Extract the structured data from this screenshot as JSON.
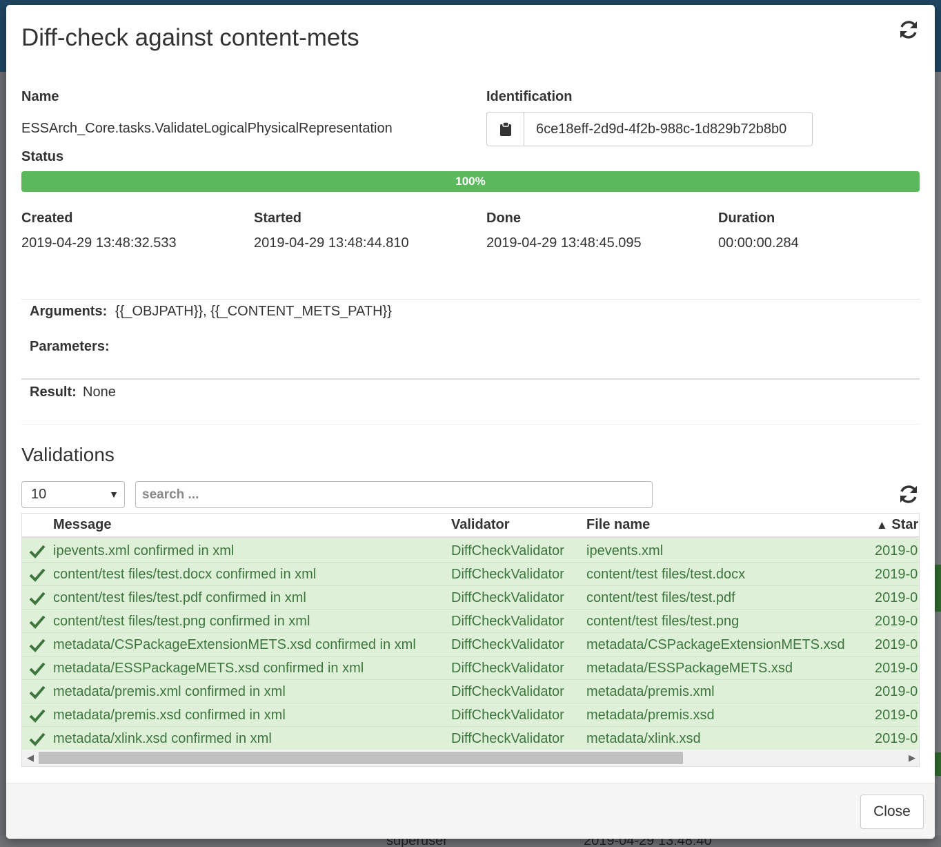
{
  "modal": {
    "title": "Diff-check against content-mets"
  },
  "details": {
    "name_label": "Name",
    "name_value": "ESSArch_Core.tasks.ValidateLogicalPhysicalRepresentation",
    "identification_label": "Identification",
    "identification_value": "6ce18eff-2d9d-4f2b-988c-1d829b72b8b0",
    "status_label": "Status",
    "progress_text": "100%",
    "progress_fraction": 1.0,
    "created_label": "Created",
    "created_value": "2019-04-29 13:48:32.533",
    "started_label": "Started",
    "started_value": "2019-04-29 13:48:44.810",
    "done_label": "Done",
    "done_value": "2019-04-29 13:48:45.095",
    "duration_label": "Duration",
    "duration_value": "00:00:00.284",
    "arguments_label": "Arguments:",
    "arguments_value": "{{_OBJPATH}}, {{_CONTENT_METS_PATH}}",
    "parameters_label": "Parameters:",
    "result_label": "Result:",
    "result_value": "None"
  },
  "validations": {
    "title": "Validations",
    "page_size": "10",
    "search_placeholder": "search ...",
    "columns": {
      "message": "Message",
      "validator": "Validator",
      "filename": "File name",
      "start_sort_arrow": "▲",
      "start": "Star"
    },
    "rows": [
      {
        "message": "ipevents.xml confirmed in xml",
        "validator": "DiffCheckValidator",
        "filename": "ipevents.xml",
        "start": "2019-0"
      },
      {
        "message": "content/test files/test.docx confirmed in xml",
        "validator": "DiffCheckValidator",
        "filename": "content/test files/test.docx",
        "start": "2019-0"
      },
      {
        "message": "content/test files/test.pdf confirmed in xml",
        "validator": "DiffCheckValidator",
        "filename": "content/test files/test.pdf",
        "start": "2019-0"
      },
      {
        "message": "content/test files/test.png confirmed in xml",
        "validator": "DiffCheckValidator",
        "filename": "content/test files/test.png",
        "start": "2019-0"
      },
      {
        "message": "metadata/CSPackageExtensionMETS.xsd confirmed in xml",
        "validator": "DiffCheckValidator",
        "filename": "metadata/CSPackageExtensionMETS.xsd",
        "start": "2019-0"
      },
      {
        "message": "metadata/ESSPackageMETS.xsd confirmed in xml",
        "validator": "DiffCheckValidator",
        "filename": "metadata/ESSPackageMETS.xsd",
        "start": "2019-0"
      },
      {
        "message": "metadata/premis.xml confirmed in xml",
        "validator": "DiffCheckValidator",
        "filename": "metadata/premis.xml",
        "start": "2019-0"
      },
      {
        "message": "metadata/premis.xsd confirmed in xml",
        "validator": "DiffCheckValidator",
        "filename": "metadata/premis.xsd",
        "start": "2019-0"
      },
      {
        "message": "metadata/xlink.xsd confirmed in xml",
        "validator": "DiffCheckValidator",
        "filename": "metadata/xlink.xsd",
        "start": "2019-0"
      }
    ]
  },
  "footer": {
    "close_label": "Close"
  },
  "background": {
    "user": "superuser",
    "timestamp": "2019-04-29 13:48:40"
  },
  "colors": {
    "success_row": "#dff0d8",
    "success_text": "#3c763d",
    "progress": "#5cb85c"
  }
}
